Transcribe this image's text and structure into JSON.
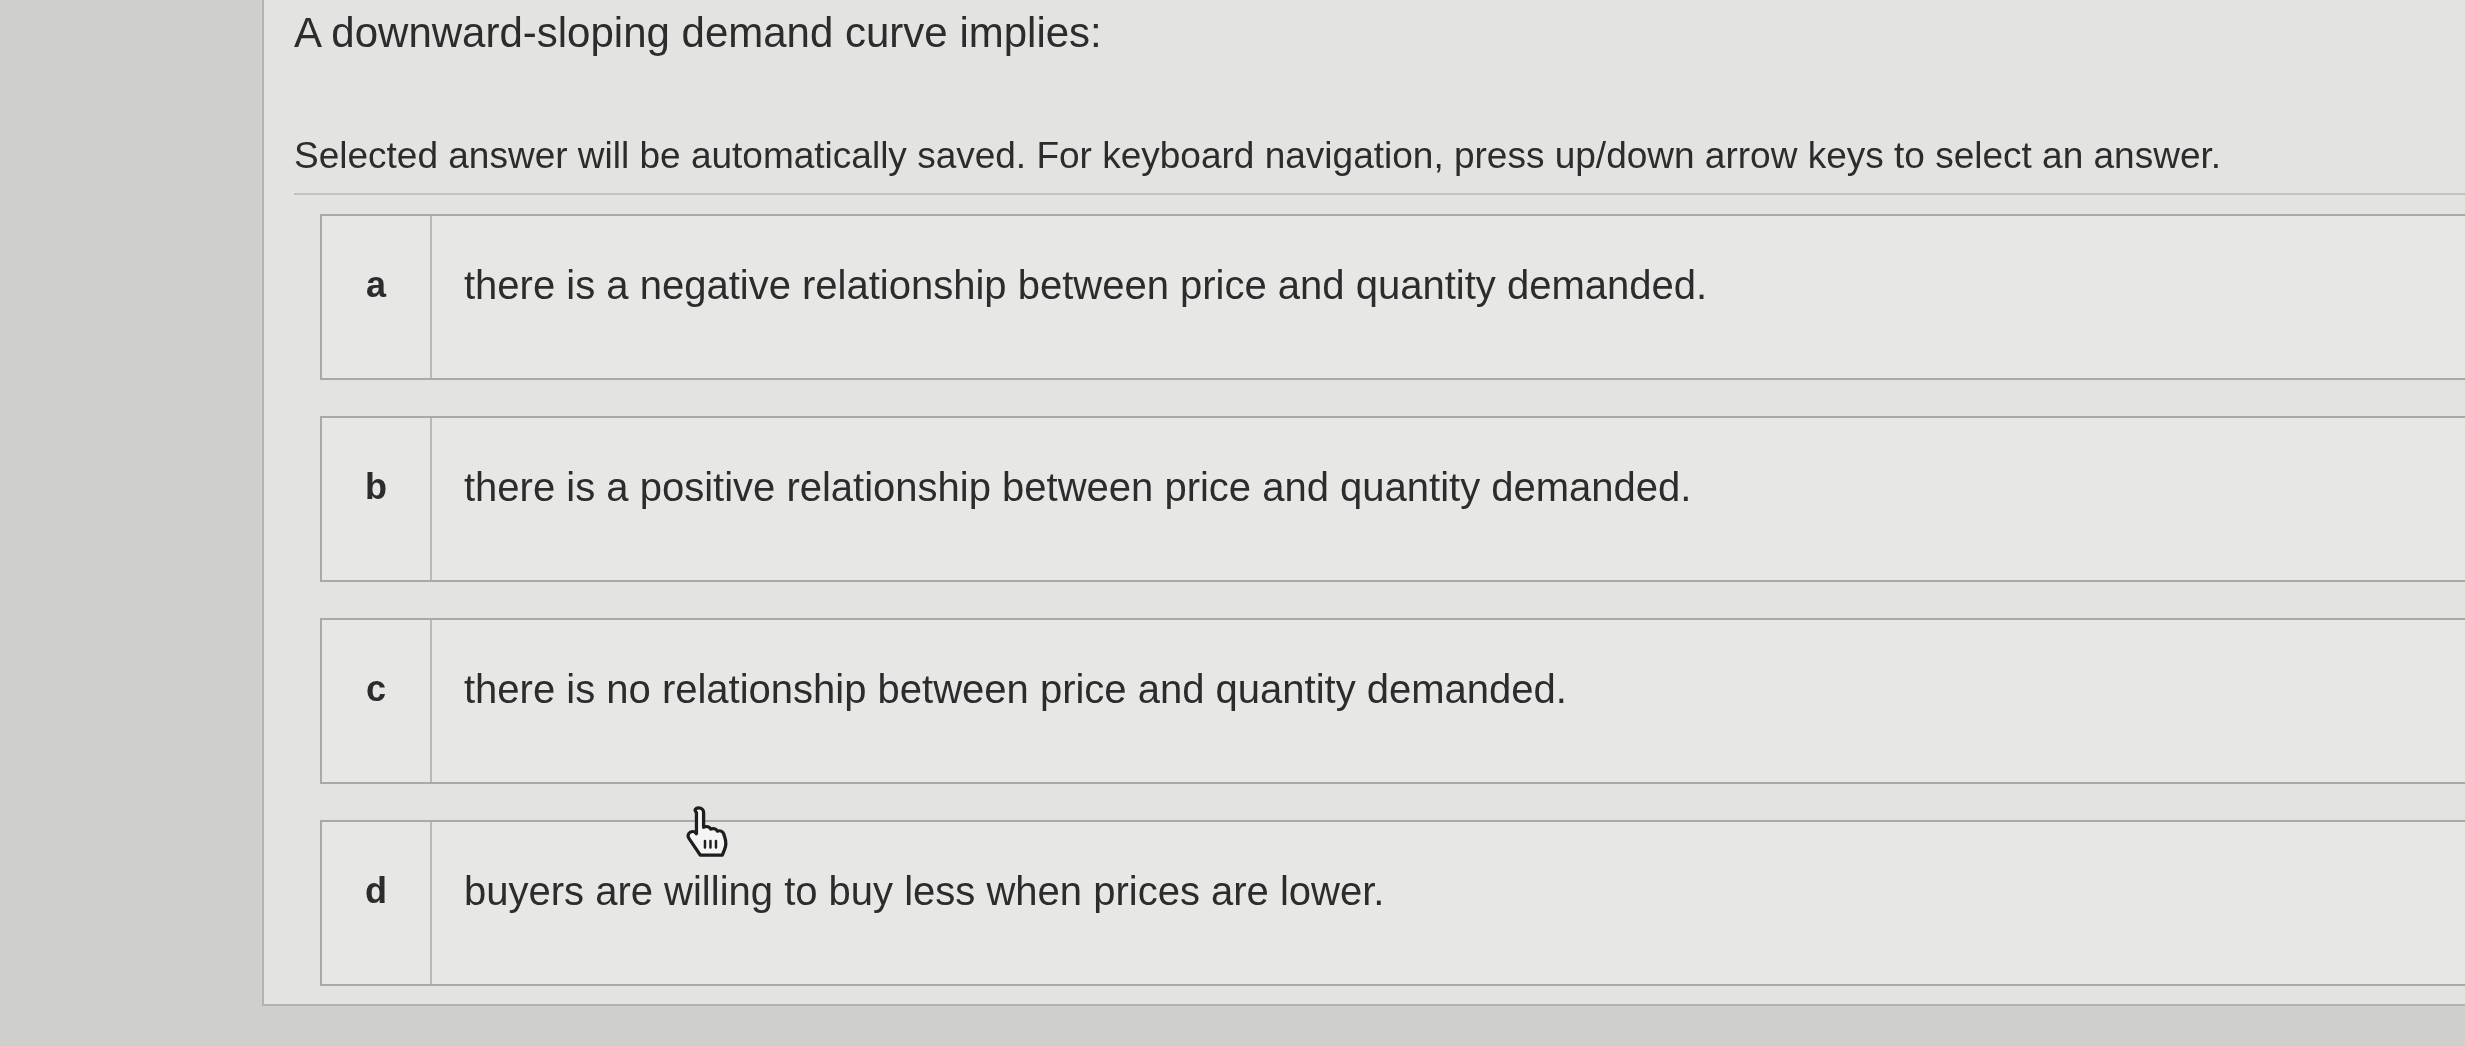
{
  "question": {
    "title": "A downward-sloping demand curve implies:",
    "instructions": "Selected answer will be automatically saved. For keyboard navigation, press up/down arrow keys to select an answer."
  },
  "options": [
    {
      "letter": "a",
      "text": "there is a negative relationship between price and quantity demanded.",
      "selected": false
    },
    {
      "letter": "b",
      "text": "there is a positive relationship between price and quantity demanded.",
      "selected": false
    },
    {
      "letter": "c",
      "text": "there is no relationship between price and quantity demanded.",
      "selected": false
    },
    {
      "letter": "d",
      "text": "buyers are willing to buy less when prices are lower.",
      "selected": false
    }
  ]
}
